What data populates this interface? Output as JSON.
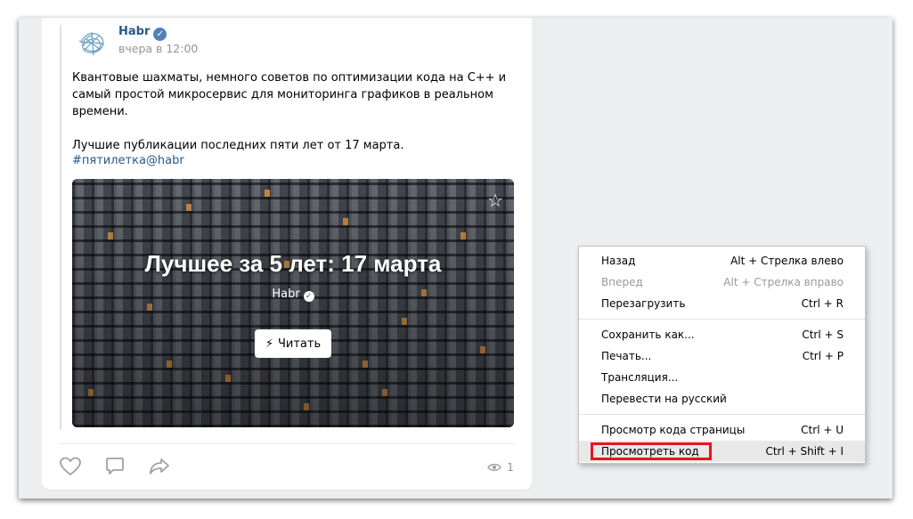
{
  "post": {
    "author": "Habr",
    "time": "вчера в 12:00",
    "paragraphs": [
      "Квантовые шахматы, немного советов по оптимизации кода на С++ и самый простой микросервис для мониторинга графиков в реальном времени.",
      "Лучшие публикации последних пяти лет от 17 марта."
    ],
    "hashtag": "#пятилетка@habr",
    "card": {
      "title": "Лучшее за 5 лет: 17 марта",
      "source": "Habr",
      "read_label": "Читать"
    },
    "views": "1"
  },
  "context_menu": {
    "items": [
      {
        "label": "Назад",
        "shortcut": "Alt + Стрелка влево"
      },
      {
        "label": "Вперед",
        "shortcut": "Alt + Стрелка вправо",
        "disabled": true
      },
      {
        "label": "Перезагрузить",
        "shortcut": "Ctrl + R"
      },
      {
        "label": "Сохранить как...",
        "shortcut": "Ctrl + S"
      },
      {
        "label": "Печать...",
        "shortcut": "Ctrl + P"
      },
      {
        "label": "Трансляция...",
        "shortcut": ""
      },
      {
        "label": "Перевести на русский",
        "shortcut": ""
      },
      {
        "label": "Просмотр кода страницы",
        "shortcut": "Ctrl + U"
      },
      {
        "label": "Просмотреть код",
        "shortcut": "Ctrl + Shift + I",
        "highlighted": true
      }
    ]
  },
  "colors": {
    "link": "#2a5885",
    "verified": "#5181b8",
    "highlight_box": "#e8141b"
  },
  "icons": [
    "verified-icon",
    "star-icon",
    "lightning-icon",
    "like-icon",
    "comment-icon",
    "share-icon",
    "eye-icon"
  ]
}
